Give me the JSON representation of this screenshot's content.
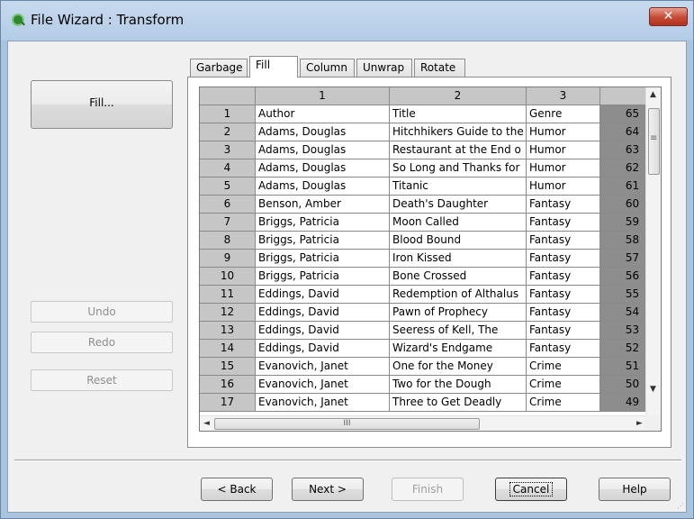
{
  "window": {
    "title": "File Wizard : Transform",
    "close_label": "✕"
  },
  "sidebar": {
    "fill_label": "Fill...",
    "undo_label": "Undo",
    "redo_label": "Redo",
    "reset_label": "Reset"
  },
  "tabs": [
    "Garbage",
    "Fill",
    "Column",
    "Unwrap",
    "Rotate"
  ],
  "active_tab": "Fill",
  "grid": {
    "headers": [
      "",
      "1",
      "2",
      "3",
      ""
    ],
    "rows": [
      [
        "1",
        "Author",
        "Title",
        "Genre",
        "65"
      ],
      [
        "2",
        "Adams, Douglas",
        "Hitchhikers Guide to the",
        "Humor",
        "64"
      ],
      [
        "3",
        "Adams, Douglas",
        "Restaurant at the End o",
        "Humor",
        "63"
      ],
      [
        "4",
        "Adams, Douglas",
        "So Long and Thanks for",
        "Humor",
        "62"
      ],
      [
        "5",
        "Adams, Douglas",
        "Titanic",
        "Humor",
        "61"
      ],
      [
        "6",
        "Benson, Amber",
        "Death's Daughter",
        "Fantasy",
        "60"
      ],
      [
        "7",
        "Briggs, Patricia",
        "Moon Called",
        "Fantasy",
        "59"
      ],
      [
        "8",
        "Briggs, Patricia",
        "Blood Bound",
        "Fantasy",
        "58"
      ],
      [
        "9",
        "Briggs, Patricia",
        "Iron Kissed",
        "Fantasy",
        "57"
      ],
      [
        "10",
        "Briggs, Patricia",
        "Bone Crossed",
        "Fantasy",
        "56"
      ],
      [
        "11",
        "Eddings, David",
        "Redemption of Althalus",
        "Fantasy",
        "55"
      ],
      [
        "12",
        "Eddings, David",
        "Pawn of Prophecy",
        "Fantasy",
        "54"
      ],
      [
        "13",
        "Eddings, David",
        "Seeress of Kell, The",
        "Fantasy",
        "53"
      ],
      [
        "14",
        "Eddings, David",
        "Wizard's Endgame",
        "Fantasy",
        "52"
      ],
      [
        "15",
        "Evanovich, Janet",
        "One for the Money",
        "Crime",
        "51"
      ],
      [
        "16",
        "Evanovich, Janet",
        "Two for the Dough",
        "Crime",
        "50"
      ],
      [
        "17",
        "Evanovich, Janet",
        "Three to Get Deadly",
        "Crime",
        "49"
      ]
    ]
  },
  "scroll": {
    "up": "▲",
    "down": "▼",
    "left": "◄",
    "right": "►",
    "grip": "III"
  },
  "footer": {
    "back_label": "< Back",
    "next_label": "Next >",
    "finish_label": "Finish",
    "cancel_label": "Cancel",
    "help_label": "Help"
  }
}
